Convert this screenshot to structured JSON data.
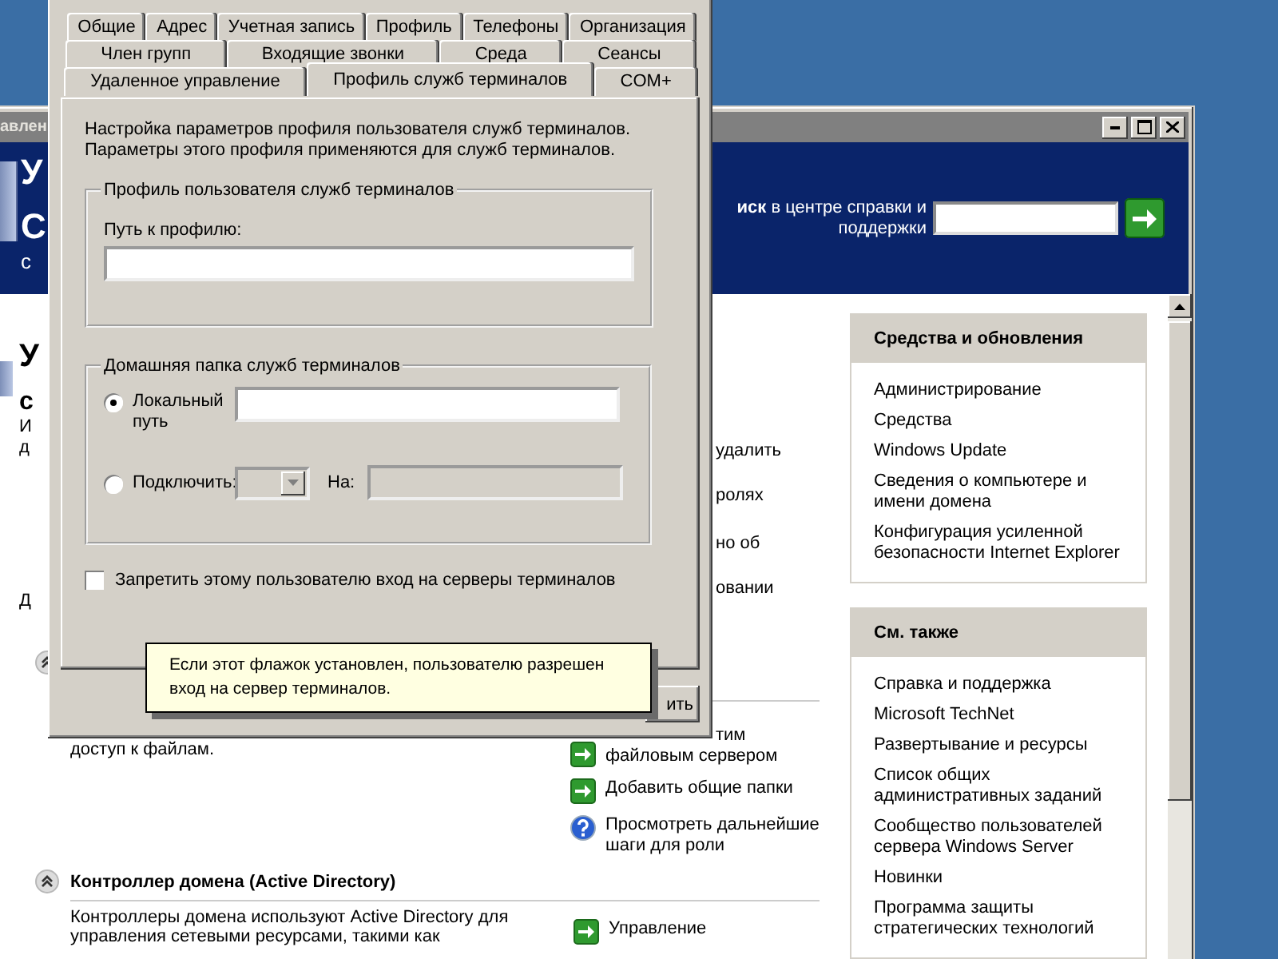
{
  "server_window": {
    "title": "авлен",
    "header": {
      "fragments": [
        {
          "kind": "title",
          "text": "У"
        },
        {
          "kind": "subtitle",
          "text": "С"
        },
        {
          "kind": "caption",
          "text": "с"
        }
      ],
      "search_label": "**иск** в центре справки и поддержки"
    },
    "left_fragments": [
      {
        "kind": "heading",
        "text": "У"
      },
      {
        "kind": "subheading",
        "text": "с"
      },
      {
        "kind": "text",
        "text": "И"
      },
      {
        "kind": "text",
        "text": "д"
      },
      {
        "kind": "gap",
        "text": "Д"
      }
    ],
    "middle_fragments": [
      "удалить",
      "ролях",
      "но об",
      "овании"
    ],
    "file_server": {
      "description": "доступ к файлам.",
      "links": [
        {
          "kind": "go",
          "label": "тим\nфайловым сервером"
        },
        {
          "kind": "go",
          "label": "Добавить общие папки"
        },
        {
          "kind": "help",
          "label": "Просмотреть дальнейшие шаги для роли"
        }
      ]
    },
    "domain_controller": {
      "title": "Контроллер домена (Active Directory)",
      "description": "Контроллеры домена используют Active Directory для\nуправления сетевыми ресурсами, такими как",
      "links": [
        {
          "kind": "go",
          "label": "Управление"
        }
      ]
    },
    "sidebar": [
      {
        "title": "Средства и обновления",
        "links": [
          "Администрирование",
          "Средства",
          "Windows Update",
          "Сведения о компьютере и имени домена",
          "Конфигурация усиленной безопасности Internet Explorer"
        ]
      },
      {
        "title": "См. также",
        "links": [
          "Справка и поддержка",
          "Microsoft TechNet",
          "Развертывание и ресурсы",
          "Список общих административных заданий",
          "Сообщество пользователей сервера Windows Server",
          "Новинки",
          "Программа защиты стратегических технологий"
        ]
      }
    ]
  },
  "dialog": {
    "tab_rows": [
      [
        {
          "label": "Общие",
          "selected": false
        },
        {
          "label": "Адрес",
          "selected": false
        },
        {
          "label": "Учетная запись",
          "selected": false
        },
        {
          "label": "Профиль",
          "selected": false
        },
        {
          "label": "Телефоны",
          "selected": false
        },
        {
          "label": "Организация",
          "selected": false
        }
      ],
      [
        {
          "label": "Член групп",
          "selected": false
        },
        {
          "label": "Входящие звонки",
          "selected": false
        },
        {
          "label": "Среда",
          "selected": false
        },
        {
          "label": "Сеансы",
          "selected": false
        }
      ],
      [
        {
          "label": "Удаленное управление",
          "selected": false
        },
        {
          "label": "Профиль служб терминалов",
          "selected": true
        },
        {
          "label": "COM+",
          "selected": false
        }
      ]
    ],
    "intro": "Настройка параметров профиля пользователя служб терминалов.\nПараметры этого профиля применяются для служб терминалов.",
    "profile_group": {
      "title": "Профиль пользователя служб терминалов",
      "path_label": "Путь к профилю:"
    },
    "home_group": {
      "title": "Домашняя папка служб терминалов",
      "options": [
        {
          "kind": "local",
          "label": "Локальный путь",
          "selected": true
        },
        {
          "kind": "connect",
          "label": "Подключить:",
          "selected": false
        }
      ],
      "drive": {
        "disabled": true
      },
      "to_field": {
        "label": "На:",
        "disabled": true
      }
    },
    "deny_logon": {
      "label": "Запретить этому пользователю вход на серверы терминалов",
      "checked": false
    },
    "buttons": [
      "ить"
    ]
  },
  "tooltip": {
    "text": "Если этот флажок установлен, пользователю разрешен\nвход на сервер терминалов."
  }
}
